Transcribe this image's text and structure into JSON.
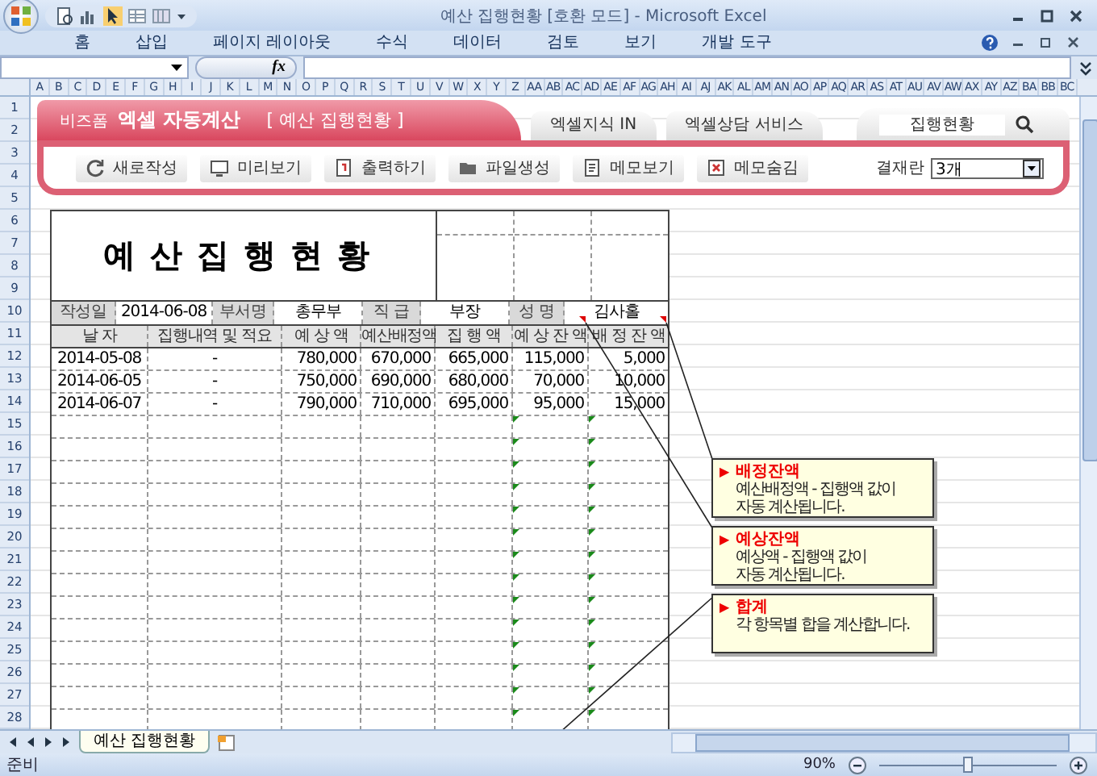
{
  "window": {
    "title": "예산 집행현황  [호환 모드] - Microsoft Excel"
  },
  "ribbon_tabs": [
    {
      "label": "홈",
      "selected": false
    },
    {
      "label": "삽입",
      "selected": false
    },
    {
      "label": "페이지 레이아웃",
      "selected": false
    },
    {
      "label": "수식",
      "selected": false
    },
    {
      "label": "데이터",
      "selected": false
    },
    {
      "label": "검토",
      "selected": false
    },
    {
      "label": "보기",
      "selected": false
    },
    {
      "label": "개발 도구",
      "selected": false
    }
  ],
  "formula_bar": {
    "fx": "fx"
  },
  "columns": [
    "A",
    "B",
    "C",
    "D",
    "E",
    "F",
    "G",
    "H",
    "I",
    "J",
    "K",
    "L",
    "M",
    "N",
    "O",
    "P",
    "Q",
    "R",
    "S",
    "T",
    "U",
    "V",
    "W",
    "X",
    "Y",
    "Z",
    "AA",
    "AB",
    "AC",
    "AD",
    "AE",
    "AF",
    "AG",
    "AH",
    "AI",
    "AJ",
    "AK",
    "AL",
    "AM",
    "AN",
    "AO",
    "AP",
    "AQ",
    "AR",
    "AS",
    "AT",
    "AU",
    "AV",
    "AW",
    "AX",
    "AY",
    "AZ",
    "BA",
    "BB",
    "BC"
  ],
  "row_numbers": [
    "1",
    "2",
    "3",
    "4",
    "5",
    "6",
    "7",
    "8",
    "9",
    "10",
    "11",
    "12",
    "13",
    "14",
    "15",
    "16",
    "17",
    "18",
    "19",
    "20",
    "21",
    "22",
    "23",
    "24",
    "25",
    "26",
    "27",
    "28"
  ],
  "banner": {
    "brand": "비즈폼",
    "product": "엑셀 자동계산",
    "subtitle": "[ 예산 집행현황 ]",
    "links": [
      "엑셀지식 IN",
      "엑셀상담 서비스"
    ],
    "search": {
      "value": "집행현황"
    },
    "buttons": [
      {
        "label": "새로작성"
      },
      {
        "label": "미리보기"
      },
      {
        "label": "출력하기"
      },
      {
        "label": "파일생성"
      },
      {
        "label": "메모보기"
      },
      {
        "label": "메모숨김"
      }
    ],
    "approval": {
      "label": "결재란",
      "value": "3개"
    }
  },
  "sheet": {
    "title": "예산집행현황",
    "info": [
      {
        "label": "작성일",
        "value": "2014-06-08"
      },
      {
        "label": "부서명",
        "value": "총무부"
      },
      {
        "label": "직 급",
        "value": "부장"
      },
      {
        "label": "성 명",
        "value": "김사홀"
      }
    ],
    "headers": [
      "날  자",
      "집행내역 및 적요",
      "예 상 액",
      "예산배정액",
      "집 행 액",
      "예 상 잔 액",
      "배 정 잔 액"
    ],
    "rows": [
      {
        "cells": [
          "2014-05-08",
          "-",
          "780,000",
          "670,000",
          "665,000",
          "115,000",
          "5,000"
        ],
        "marked": false
      },
      {
        "cells": [
          "2014-06-05",
          "-",
          "750,000",
          "690,000",
          "680,000",
          "70,000",
          "10,000"
        ],
        "marked": false
      },
      {
        "cells": [
          "2014-06-07",
          "-",
          "790,000",
          "710,000",
          "695,000",
          "95,000",
          "15,000"
        ],
        "marked": false
      },
      {
        "cells": [],
        "marked": true
      },
      {
        "cells": [],
        "marked": true
      },
      {
        "cells": [],
        "marked": true
      },
      {
        "cells": [],
        "marked": true
      },
      {
        "cells": [],
        "marked": true
      },
      {
        "cells": [],
        "marked": true
      },
      {
        "cells": [],
        "marked": true
      },
      {
        "cells": [],
        "marked": true
      },
      {
        "cells": [],
        "marked": true
      },
      {
        "cells": [],
        "marked": true
      },
      {
        "cells": [],
        "marked": true
      },
      {
        "cells": [],
        "marked": true
      },
      {
        "cells": [],
        "marked": true
      },
      {
        "cells": [],
        "marked": true
      }
    ]
  },
  "comments": [
    {
      "marker": "▶",
      "title": "배정잔액",
      "body": "예산배정액 - 집행액 값이\n자동 계산됩니다."
    },
    {
      "marker": "▶",
      "title": "예상잔액",
      "body": "예상액 - 집행액 값이\n자동 계산됩니다."
    },
    {
      "marker": "▶",
      "title": "합계",
      "body": "각 항목별 합을 계산합니다."
    }
  ],
  "sheet_tabs": [
    {
      "label": "예산 집행현황",
      "selected": true
    }
  ],
  "status_bar": {
    "status": "준비",
    "zoom": {
      "reading": "90%",
      "level": 0.5
    }
  }
}
